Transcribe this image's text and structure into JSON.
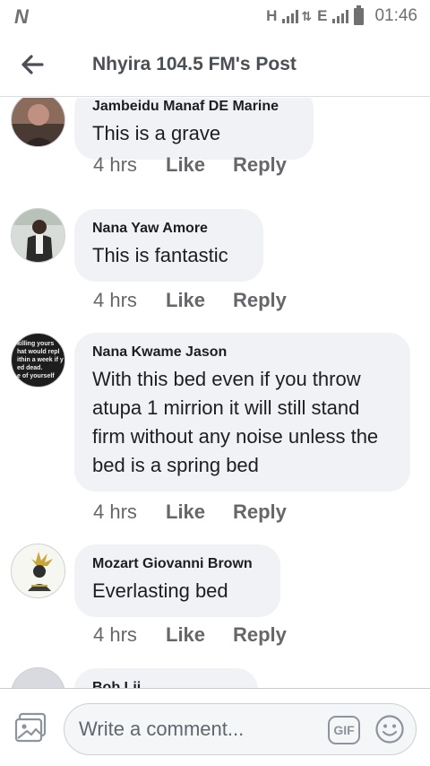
{
  "status_bar": {
    "carrier_logo": "N",
    "network_1": "H",
    "network_2": "E",
    "time": "01:46"
  },
  "header": {
    "title": "Nhyira 104.5 FM's Post",
    "back_icon": "arrow-left-icon"
  },
  "comments": [
    {
      "author": "Jambeidu Manaf DE Marine",
      "text": "This is a grave",
      "time": "4 hrs",
      "like": "Like",
      "reply": "Reply"
    },
    {
      "author": "Nana Yaw Amore",
      "text": "This is fantastic",
      "time": "4 hrs",
      "like": "Like",
      "reply": "Reply"
    },
    {
      "author": "Nana Kwame Jason",
      "text": "With this bed even if you throw atupa 1 mirrion it will still stand firm without any noise unless the bed is a spring bed",
      "time": "4 hrs",
      "like": "Like",
      "reply": "Reply",
      "avatar_text": [
        "killing yours",
        "hat would repl",
        "ithin a week if y",
        "ed dead.",
        "e of yourself"
      ]
    },
    {
      "author": "Mozart Giovanni Brown",
      "text": "Everlasting bed",
      "time": "4 hrs",
      "like": "Like",
      "reply": "Reply"
    },
    {
      "author": "Bob Lii"
    }
  ],
  "composer": {
    "placeholder": "Write a comment...",
    "gif_label": "GIF",
    "photo_icon": "photo-icon",
    "emoji_icon": "emoji-icon"
  },
  "colors": {
    "bubble_bg": "#f0f2f5",
    "meta_text": "#65676b",
    "title_text": "#4b4f56"
  }
}
